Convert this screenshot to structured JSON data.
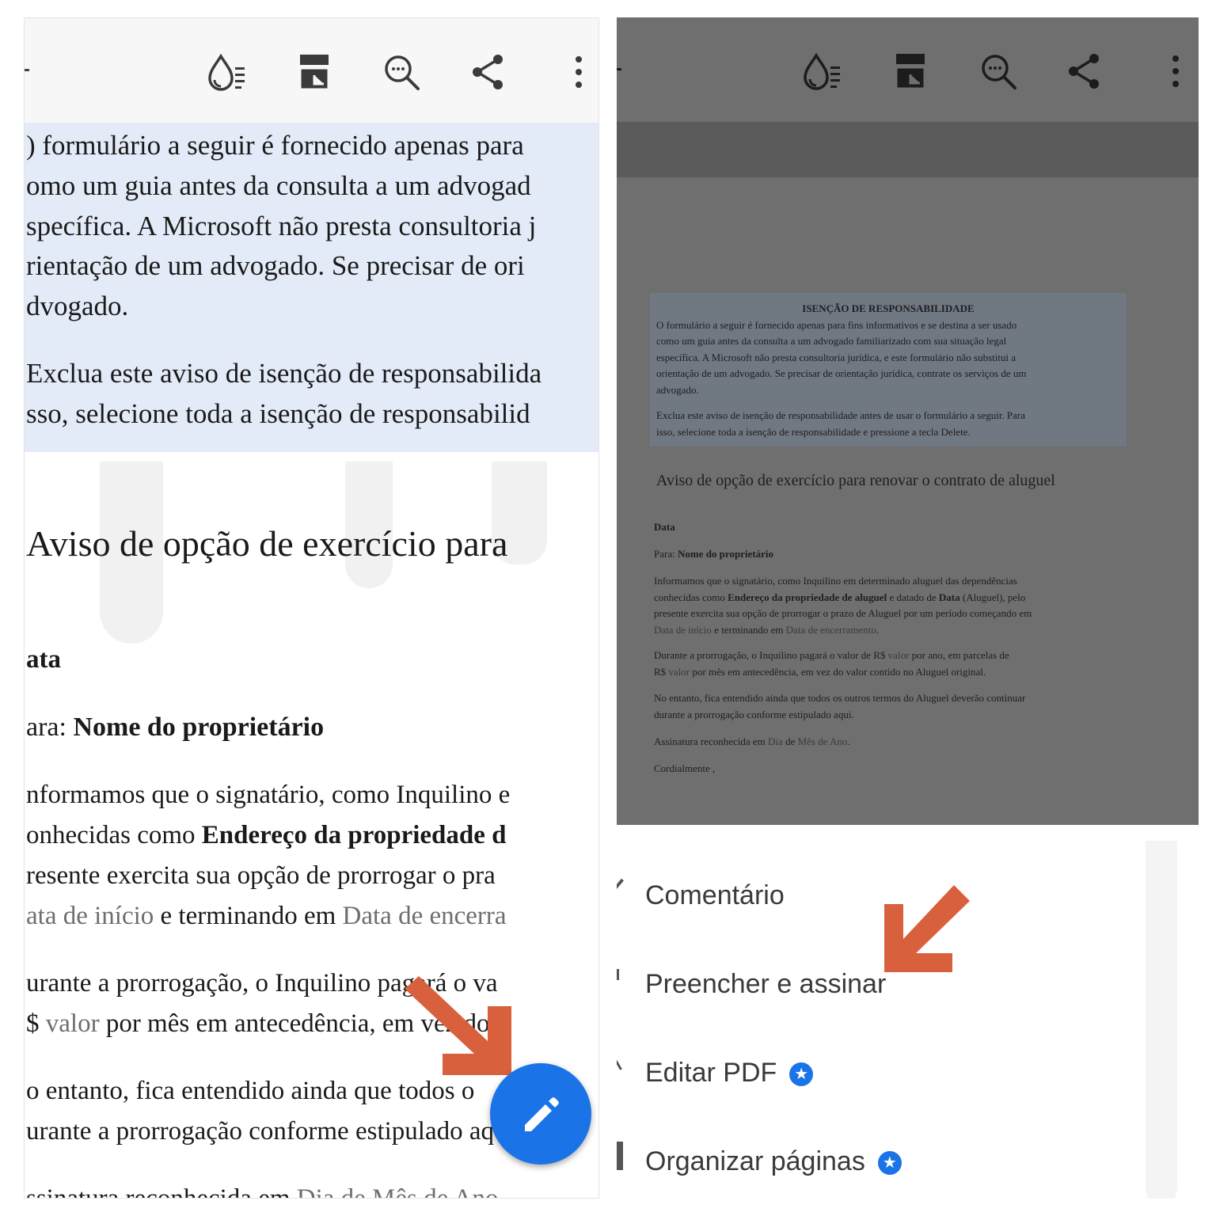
{
  "left": {
    "disclaimer_lines": [
      ") formulário a seguir é fornecido apenas para",
      "omo um guia antes da consulta a um advogad",
      "specífica. A Microsoft não presta consultoria j",
      "rientação de um advogado. Se precisar de ori",
      "dvogado.",
      "Exclua este aviso de isenção de responsabilida",
      "sso, selecione toda a isenção de responsabilid"
    ],
    "title": "Aviso de opção de exercício para",
    "date_label": "ata",
    "to_prefix": "ara: ",
    "to_name": "Nome do proprietário",
    "p1_l1": "nformamos que o signatário, como Inquilino e",
    "p1_l2a": "onhecidas como ",
    "p1_l2b": "Endereço da propriedade d",
    "p1_l3": "resente exercita sua opção de prorrogar o pra",
    "p1_l4a": "ata de início",
    "p1_l4b": " e terminando em ",
    "p1_l4c": "Data de encerra",
    "p2_l1": "urante a prorrogação, o Inquilino pagará o va",
    "p2_l2a": "$ ",
    "p2_l2b": "valor",
    "p2_l2c": " por mês em antecedência, em vez do v",
    "p3_l1": "o entanto, fica entendido ainda que todos o",
    "p3_l2": "urante a prorrogação conforme estipulado aq",
    "p4_a": "ssinatura reconhecida em ",
    "p4_b": "Dia de Mês de Ano"
  },
  "right": {
    "disclaimer_title": "ISENÇÃO DE RESPONSABILIDADE",
    "disclaimer_lines": [
      "O formulário a seguir é fornecido apenas para fins informativos e se destina a ser usado",
      "como um guia antes da consulta a um advogado familiarizado com sua situação legal",
      "específica. A Microsoft não presta consultoria jurídica, e este formulário não substitui a",
      "orientação de um advogado. Se precisar de orientação jurídica, contrate os serviços de um",
      "advogado."
    ],
    "disclaimer_lines2": [
      "Exclua este aviso de isenção de responsabilidade antes de usar o formulário a seguir. Para",
      "isso, selecione toda a isenção de responsabilidade e pressione a tecla Delete."
    ],
    "title": "Aviso de opção de exercício para renovar o contrato de aluguel",
    "date_label": "Data",
    "to_prefix": "Para: ",
    "to_name": "Nome do proprietário",
    "p1_l1": "Informamos que o signatário, como Inquilino em determinado aluguel das dependências",
    "p1_l2a": "conhecidas como ",
    "p1_l2b": "Endereço da propriedade de aluguel",
    "p1_l2c": " e datado de ",
    "p1_l2d": "Data",
    "p1_l2e": " (Aluguel), pelo",
    "p1_l3": "presente exercita sua opção de prorrogar o prazo de Aluguel por um período começando em",
    "p1_l4a": "Data de início",
    "p1_l4b": " e terminando em ",
    "p1_l4c": "Data de encerramento",
    "p1_l4d": ".",
    "p2_l1a": "Durante a prorrogação, o Inquilino pagará o valor de R$ ",
    "p2_l1b": "valor",
    "p2_l1c": " por ano, em parcelas de",
    "p2_l2a": "R$ ",
    "p2_l2b": "valor",
    "p2_l2c": " por mês em antecedência, em vez do valor contido no Aluguel original.",
    "p3_l1": "No entanto, fica entendido ainda que todos os outros termos do Aluguel deverão continuar",
    "p3_l2": "durante a prorrogação conforme estipulado aqui.",
    "p4_a": "Assinatura reconhecida em ",
    "p4_b": "Dia",
    "p4_c": " de ",
    "p4_d": "Mês de Ano",
    "p4_e": ".",
    "closing": "Cordialmente ,"
  },
  "menu": {
    "comment": "Comentário",
    "fill_sign": "Preencher e assinar",
    "edit_pdf": "Editar PDF",
    "organize": "Organizar páginas"
  },
  "icons": {
    "toolbar": [
      "liquid-mode-icon",
      "page-view-icon",
      "search-icon",
      "share-icon",
      "more-options-icon"
    ],
    "fab": "edit-pencil-icon",
    "premium": "premium-star-icon"
  },
  "colors": {
    "fab": "#1b73e8",
    "highlight": "#e4ebf8",
    "overlay": "#6f6f6f",
    "annotation_arrow": "#d9603c"
  }
}
